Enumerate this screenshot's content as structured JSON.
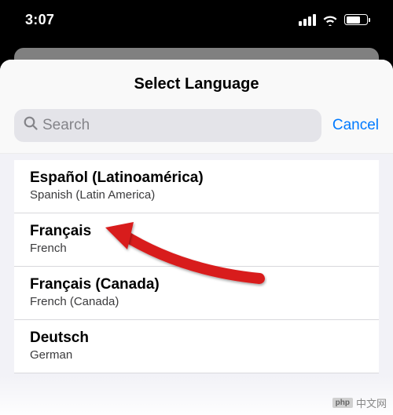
{
  "status": {
    "time": "3:07"
  },
  "sheet": {
    "title": "Select Language",
    "search_placeholder": "Search",
    "cancel_label": "Cancel"
  },
  "languages": [
    {
      "name": "Español (Latinoamérica)",
      "english": "Spanish (Latin America)"
    },
    {
      "name": "Français",
      "english": "French"
    },
    {
      "name": "Français (Canada)",
      "english": "French (Canada)"
    },
    {
      "name": "Deutsch",
      "english": "German"
    }
  ],
  "watermark": {
    "logo": "php",
    "text": "中文网"
  }
}
